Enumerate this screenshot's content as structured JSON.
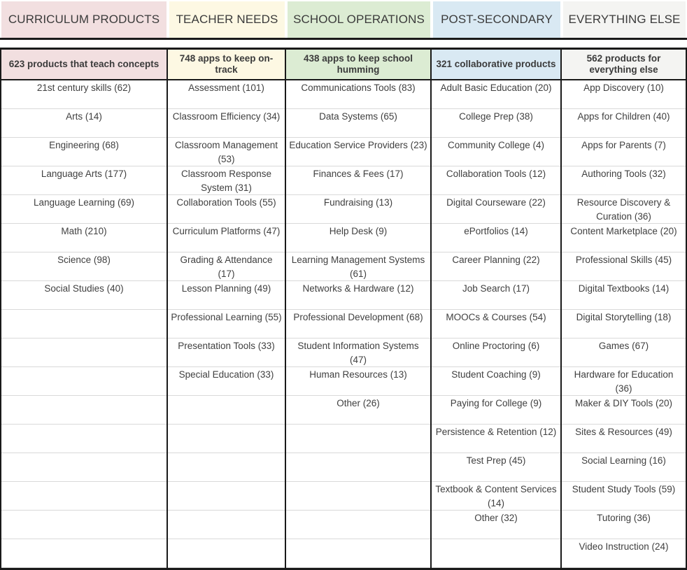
{
  "tabs": [
    {
      "label": "CURRICULUM PRODUCTS",
      "color": "#f2dfe0"
    },
    {
      "label": "TEACHER NEEDS",
      "color": "#fdf8e3"
    },
    {
      "label": "SCHOOL OPERATIONS",
      "color": "#dcecd3"
    },
    {
      "label": "POST-SECONDARY",
      "color": "#d9e9f3"
    },
    {
      "label": "EVERYTHING ELSE",
      "color": "#f4f4f2"
    }
  ],
  "columns": [
    {
      "header": "623 products that teach concepts",
      "total": 623,
      "items": [
        "21st century skills (62)",
        "Arts (14)",
        "Engineering (68)",
        "Language Arts (177)",
        "Language Learning (69)",
        "Math (210)",
        "Science (98)",
        "Social Studies (40)"
      ]
    },
    {
      "header": "748 apps to keep on-track",
      "total": 748,
      "items": [
        "Assessment (101)",
        "Classroom Efficiency (34)",
        "Classroom Management (53)",
        "Classroom Response System (31)",
        "Collaboration Tools (55)",
        "Curriculum Platforms (47)",
        "Grading & Attendance (17)",
        "Lesson Planning (49)",
        "Professional Learning (55)",
        "Presentation Tools (33)",
        "Special Education (33)"
      ]
    },
    {
      "header": "438 apps to keep school humming",
      "total": 438,
      "items": [
        "Communications Tools (83)",
        "Data Systems (65)",
        "Education Service Providers (23)",
        "Finances & Fees (17)",
        "Fundraising (13)",
        "Help Desk (9)",
        "Learning Management Systems (61)",
        "Networks & Hardware (12)",
        "Professional Development (68)",
        "Student Information Systems (47)",
        "Human Resources (13)",
        "Other (26)"
      ]
    },
    {
      "header": "321 collaborative products",
      "total": 321,
      "items": [
        "Adult Basic Education (20)",
        "College Prep (38)",
        "Community College (4)",
        "Collaboration Tools (12)",
        "Digital Courseware (22)",
        "ePortfolios (14)",
        "Career Planning (22)",
        "Job Search (17)",
        "MOOCs & Courses (54)",
        "Online Proctoring (6)",
        "Student Coaching (9)",
        "Paying for College (9)",
        "Persistence & Retention (12)",
        "Test Prep (45)",
        "Textbook & Content Services (14)",
        "Other (32)"
      ]
    },
    {
      "header": "562 products for everything else",
      "total": 562,
      "items": [
        "App Discovery (10)",
        "Apps for Children (40)",
        "Apps for Parents (7)",
        "Authoring Tools (32)",
        "Resource Discovery & Curation (36)",
        "Content Marketplace (20)",
        "Professional Skills (45)",
        "Digital Textbooks (14)",
        "Digital Storytelling (18)",
        "Games (67)",
        "Hardware for Education (36)",
        "Maker & DIY Tools (20)",
        "Sites & Resources (49)",
        "Social Learning (16)",
        "Student Study Tools (59)",
        "Tutoring (36)",
        "Video Instruction (24)"
      ]
    }
  ],
  "row_count": 17
}
